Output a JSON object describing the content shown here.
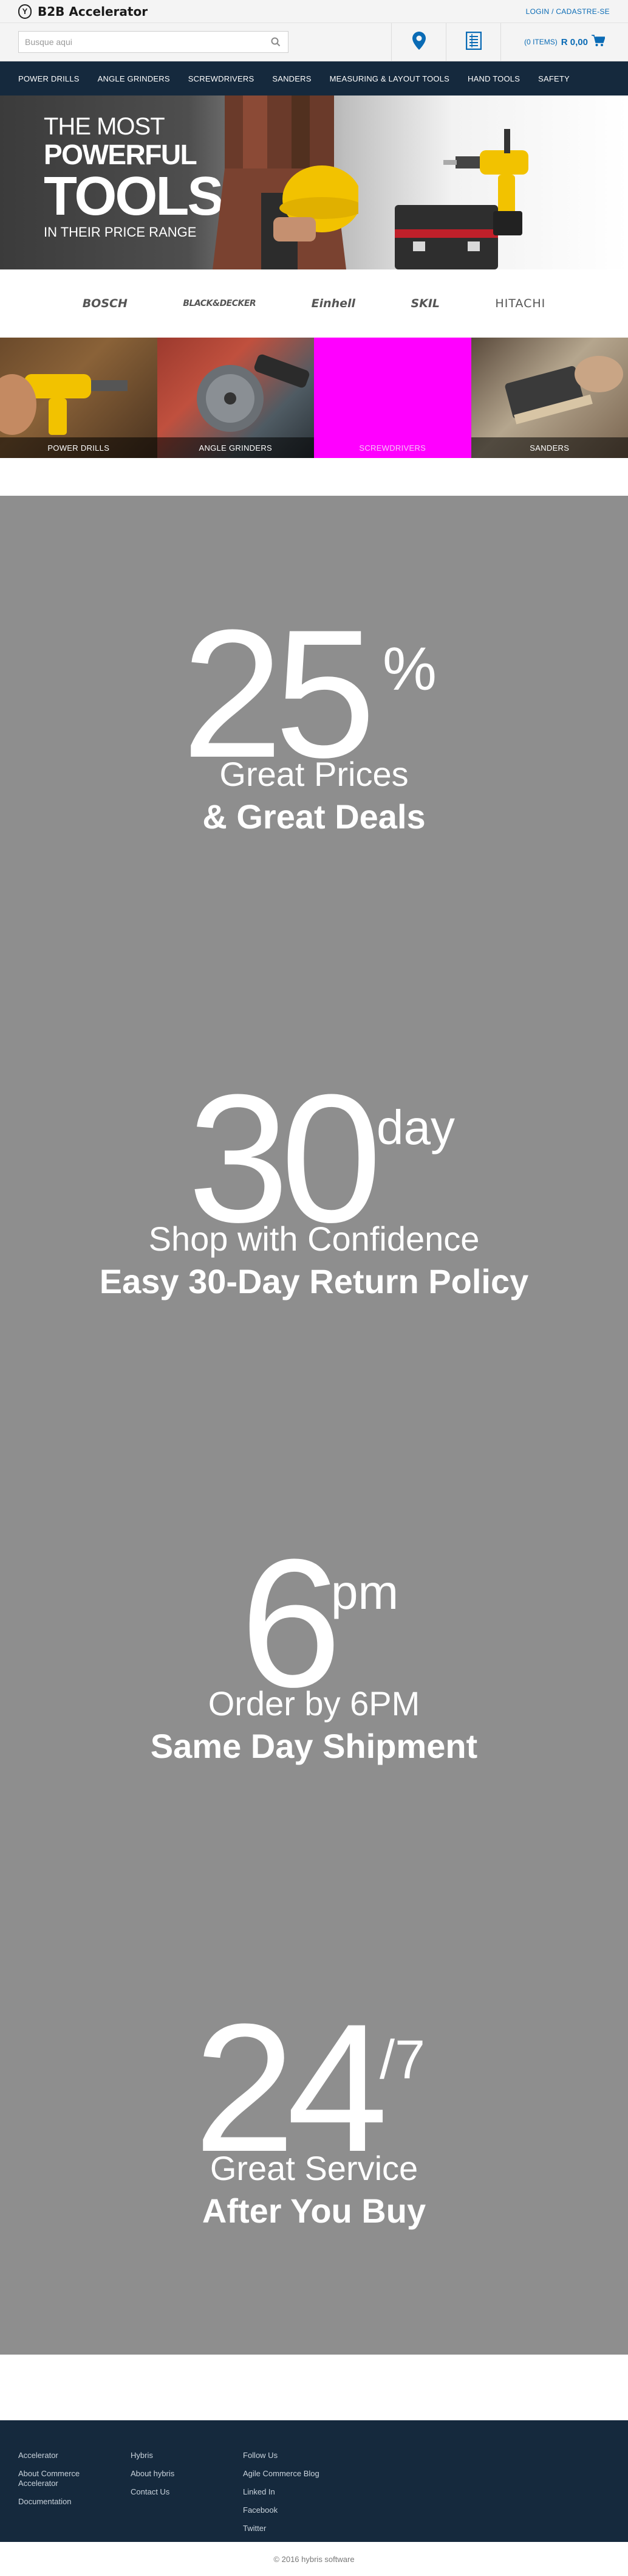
{
  "header": {
    "brand": "B2B Accelerator",
    "brand_mark": "Y",
    "login": "LOGIN / CADASTRE-SE",
    "search_placeholder": "Busque aqui",
    "cart_count": "(0 ITEMS)",
    "cart_total": "R 0,00",
    "icons": [
      "location-pin-icon",
      "order-form-icon",
      "cart-icon",
      "search-icon"
    ]
  },
  "nav": [
    "POWER DRILLS",
    "ANGLE GRINDERS",
    "SCREWDRIVERS",
    "SANDERS",
    "MEASURING & LAYOUT TOOLS",
    "HAND TOOLS",
    "SAFETY"
  ],
  "hero": {
    "line1": "THE MOST",
    "line2": "POWERFUL",
    "line3": "TOOLS",
    "line4": "IN THEIR PRICE RANGE"
  },
  "brands": [
    "BOSCH",
    "BLACK&DECKER",
    "Einhell",
    "SKIL",
    "HITACHI"
  ],
  "categories": [
    "POWER DRILLS",
    "ANGLE GRINDERS",
    "SCREWDRIVERS",
    "SANDERS"
  ],
  "promos": [
    {
      "number": "25",
      "sup": "%",
      "line1": "Great Prices",
      "line2": "& Great Deals"
    },
    {
      "number": "30",
      "sup": "day",
      "line1": "Shop with Confidence",
      "line2": "Easy 30-Day Return Policy"
    },
    {
      "number": "6",
      "sup": "pm",
      "line1": "Order by 6PM",
      "line2": "Same Day Shipment"
    },
    {
      "number": "24",
      "sup": "/7",
      "line1": "Great Service",
      "line2": "After You Buy"
    }
  ],
  "footer": {
    "col1": [
      "Accelerator",
      "About Commerce Accelerator",
      "Documentation"
    ],
    "col2": [
      "Hybris",
      "About hybris",
      "Contact Us"
    ],
    "col3": [
      "Follow Us",
      "Agile Commerce Blog",
      "Linked In",
      "Facebook",
      "Twitter"
    ],
    "copyright": "© 2016 hybris software"
  },
  "colors": {
    "nav_bg": "#15293d",
    "accent": "#0a6bb5",
    "promo_bg": "#8e8e8e"
  }
}
